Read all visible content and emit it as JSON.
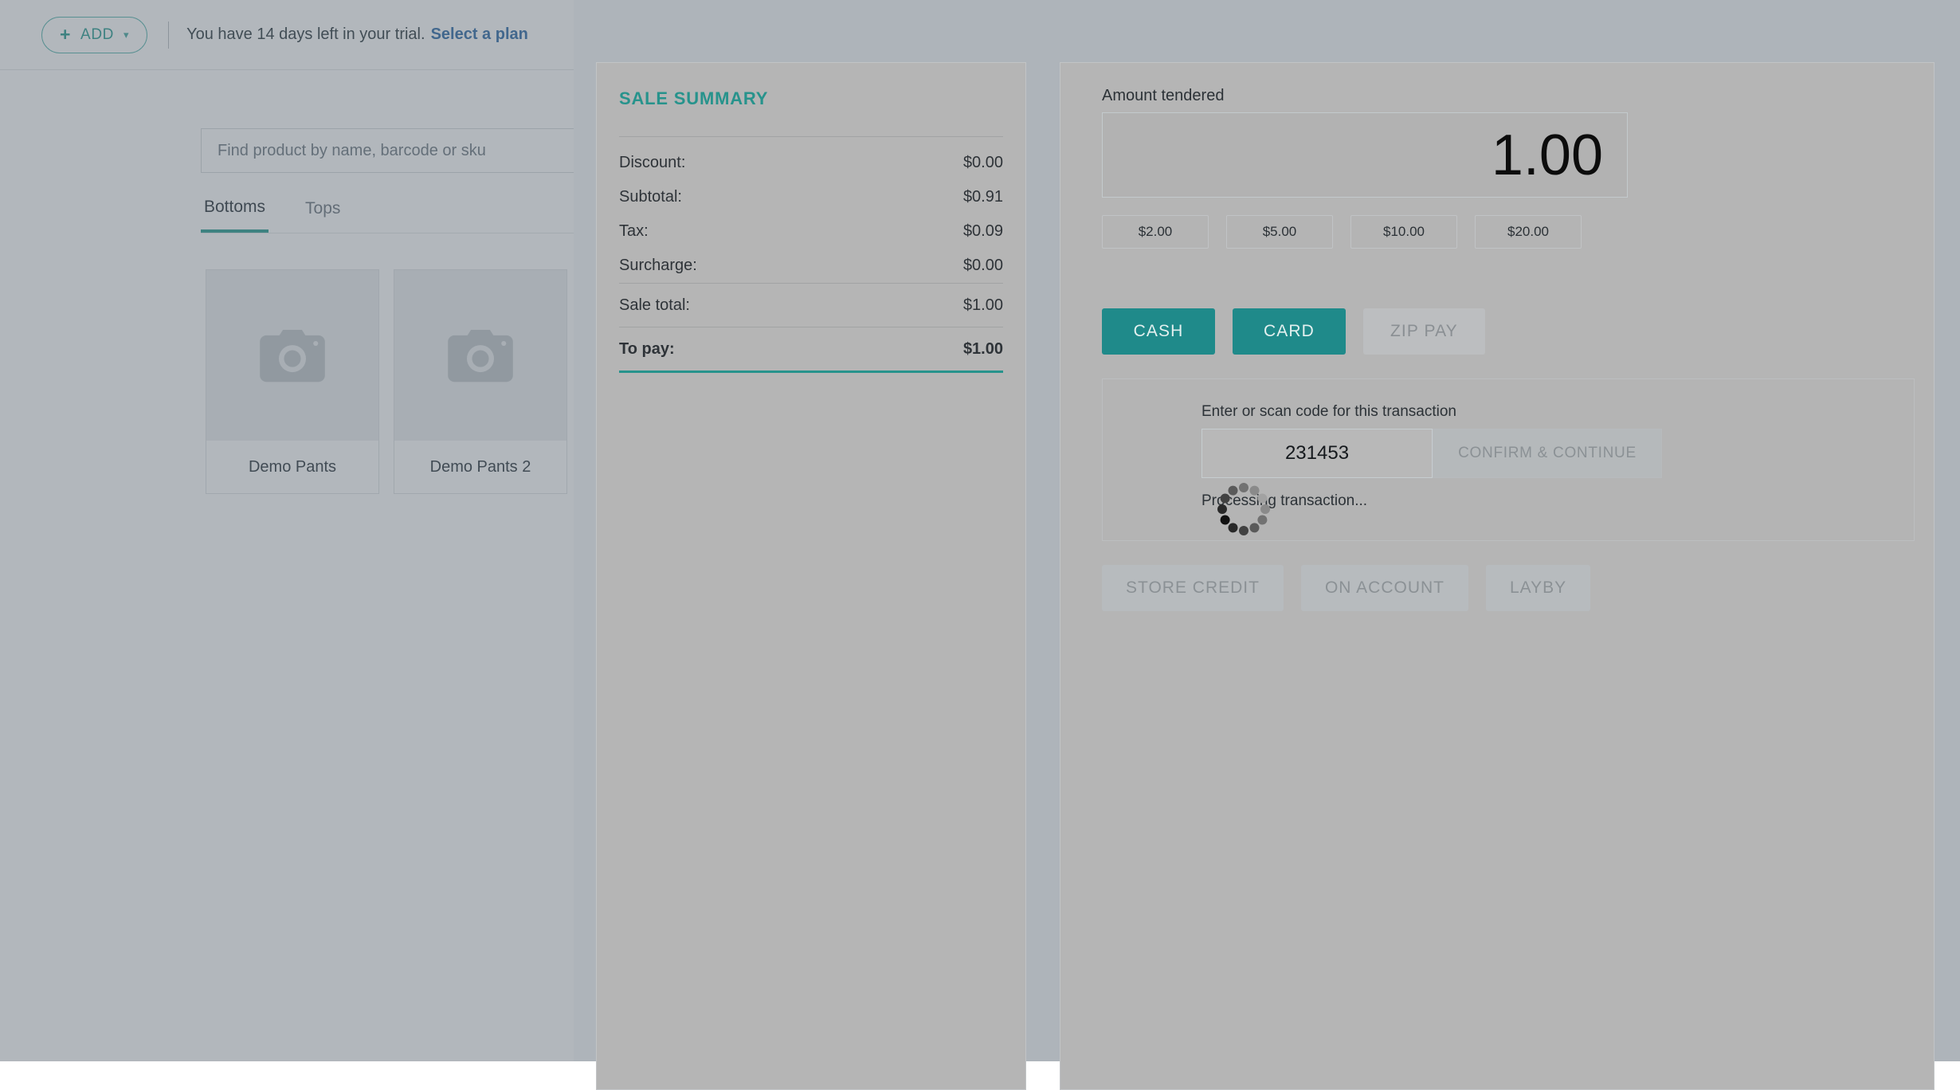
{
  "topbar": {
    "add_button_label": "ADD",
    "add_icon": "plus-icon",
    "caret_icon": "chevron-down-icon",
    "trial_text": "You have 14 days left in your trial.",
    "trial_link_label": "Select a plan"
  },
  "product_pane": {
    "search_placeholder": "Find product by name, barcode or sku",
    "search_value": "",
    "tabs": [
      {
        "label": "Bottoms",
        "active": true
      },
      {
        "label": "Tops",
        "active": false
      }
    ],
    "products": [
      {
        "name": "Demo Pants",
        "thumb_icon": "camera-icon"
      },
      {
        "name": "Demo Pants 2",
        "thumb_icon": "camera-icon"
      }
    ]
  },
  "sale_summary": {
    "title": "SALE SUMMARY",
    "rows": [
      {
        "label": "Discount:",
        "value": "$0.00"
      },
      {
        "label": "Subtotal:",
        "value": "$0.91"
      },
      {
        "label": "Tax:",
        "value": "$0.09"
      },
      {
        "label": "Surcharge:",
        "value": "$0.00"
      }
    ],
    "sale_total": {
      "label": "Sale total:",
      "value": "$1.00"
    },
    "to_pay": {
      "label": "To pay:",
      "value": "$1.00"
    }
  },
  "payment": {
    "amount_label": "Amount tendered",
    "amount_value": "1.00",
    "quick_amounts": [
      "$2.00",
      "$5.00",
      "$10.00",
      "$20.00"
    ],
    "methods": [
      {
        "label": "CASH",
        "state": "primary"
      },
      {
        "label": "CARD",
        "state": "primary"
      },
      {
        "label": "ZIP PAY",
        "state": "disabled"
      }
    ],
    "transaction": {
      "label": "Enter or scan code for this transaction",
      "code_value": "231453",
      "code_placeholder": "",
      "confirm_label": "CONFIRM & CONTINUE",
      "status_text": "Processing transaction...",
      "spinner_icon": "loading-spinner-icon"
    },
    "secondary_methods": [
      "STORE CREDIT",
      "ON ACCOUNT",
      "LAYBY"
    ]
  },
  "colors": {
    "accent_teal": "#1f8a8a",
    "heading_teal": "#27938c",
    "link_blue": "#2f6ca8",
    "disabled_grey": "#bcbec0"
  }
}
